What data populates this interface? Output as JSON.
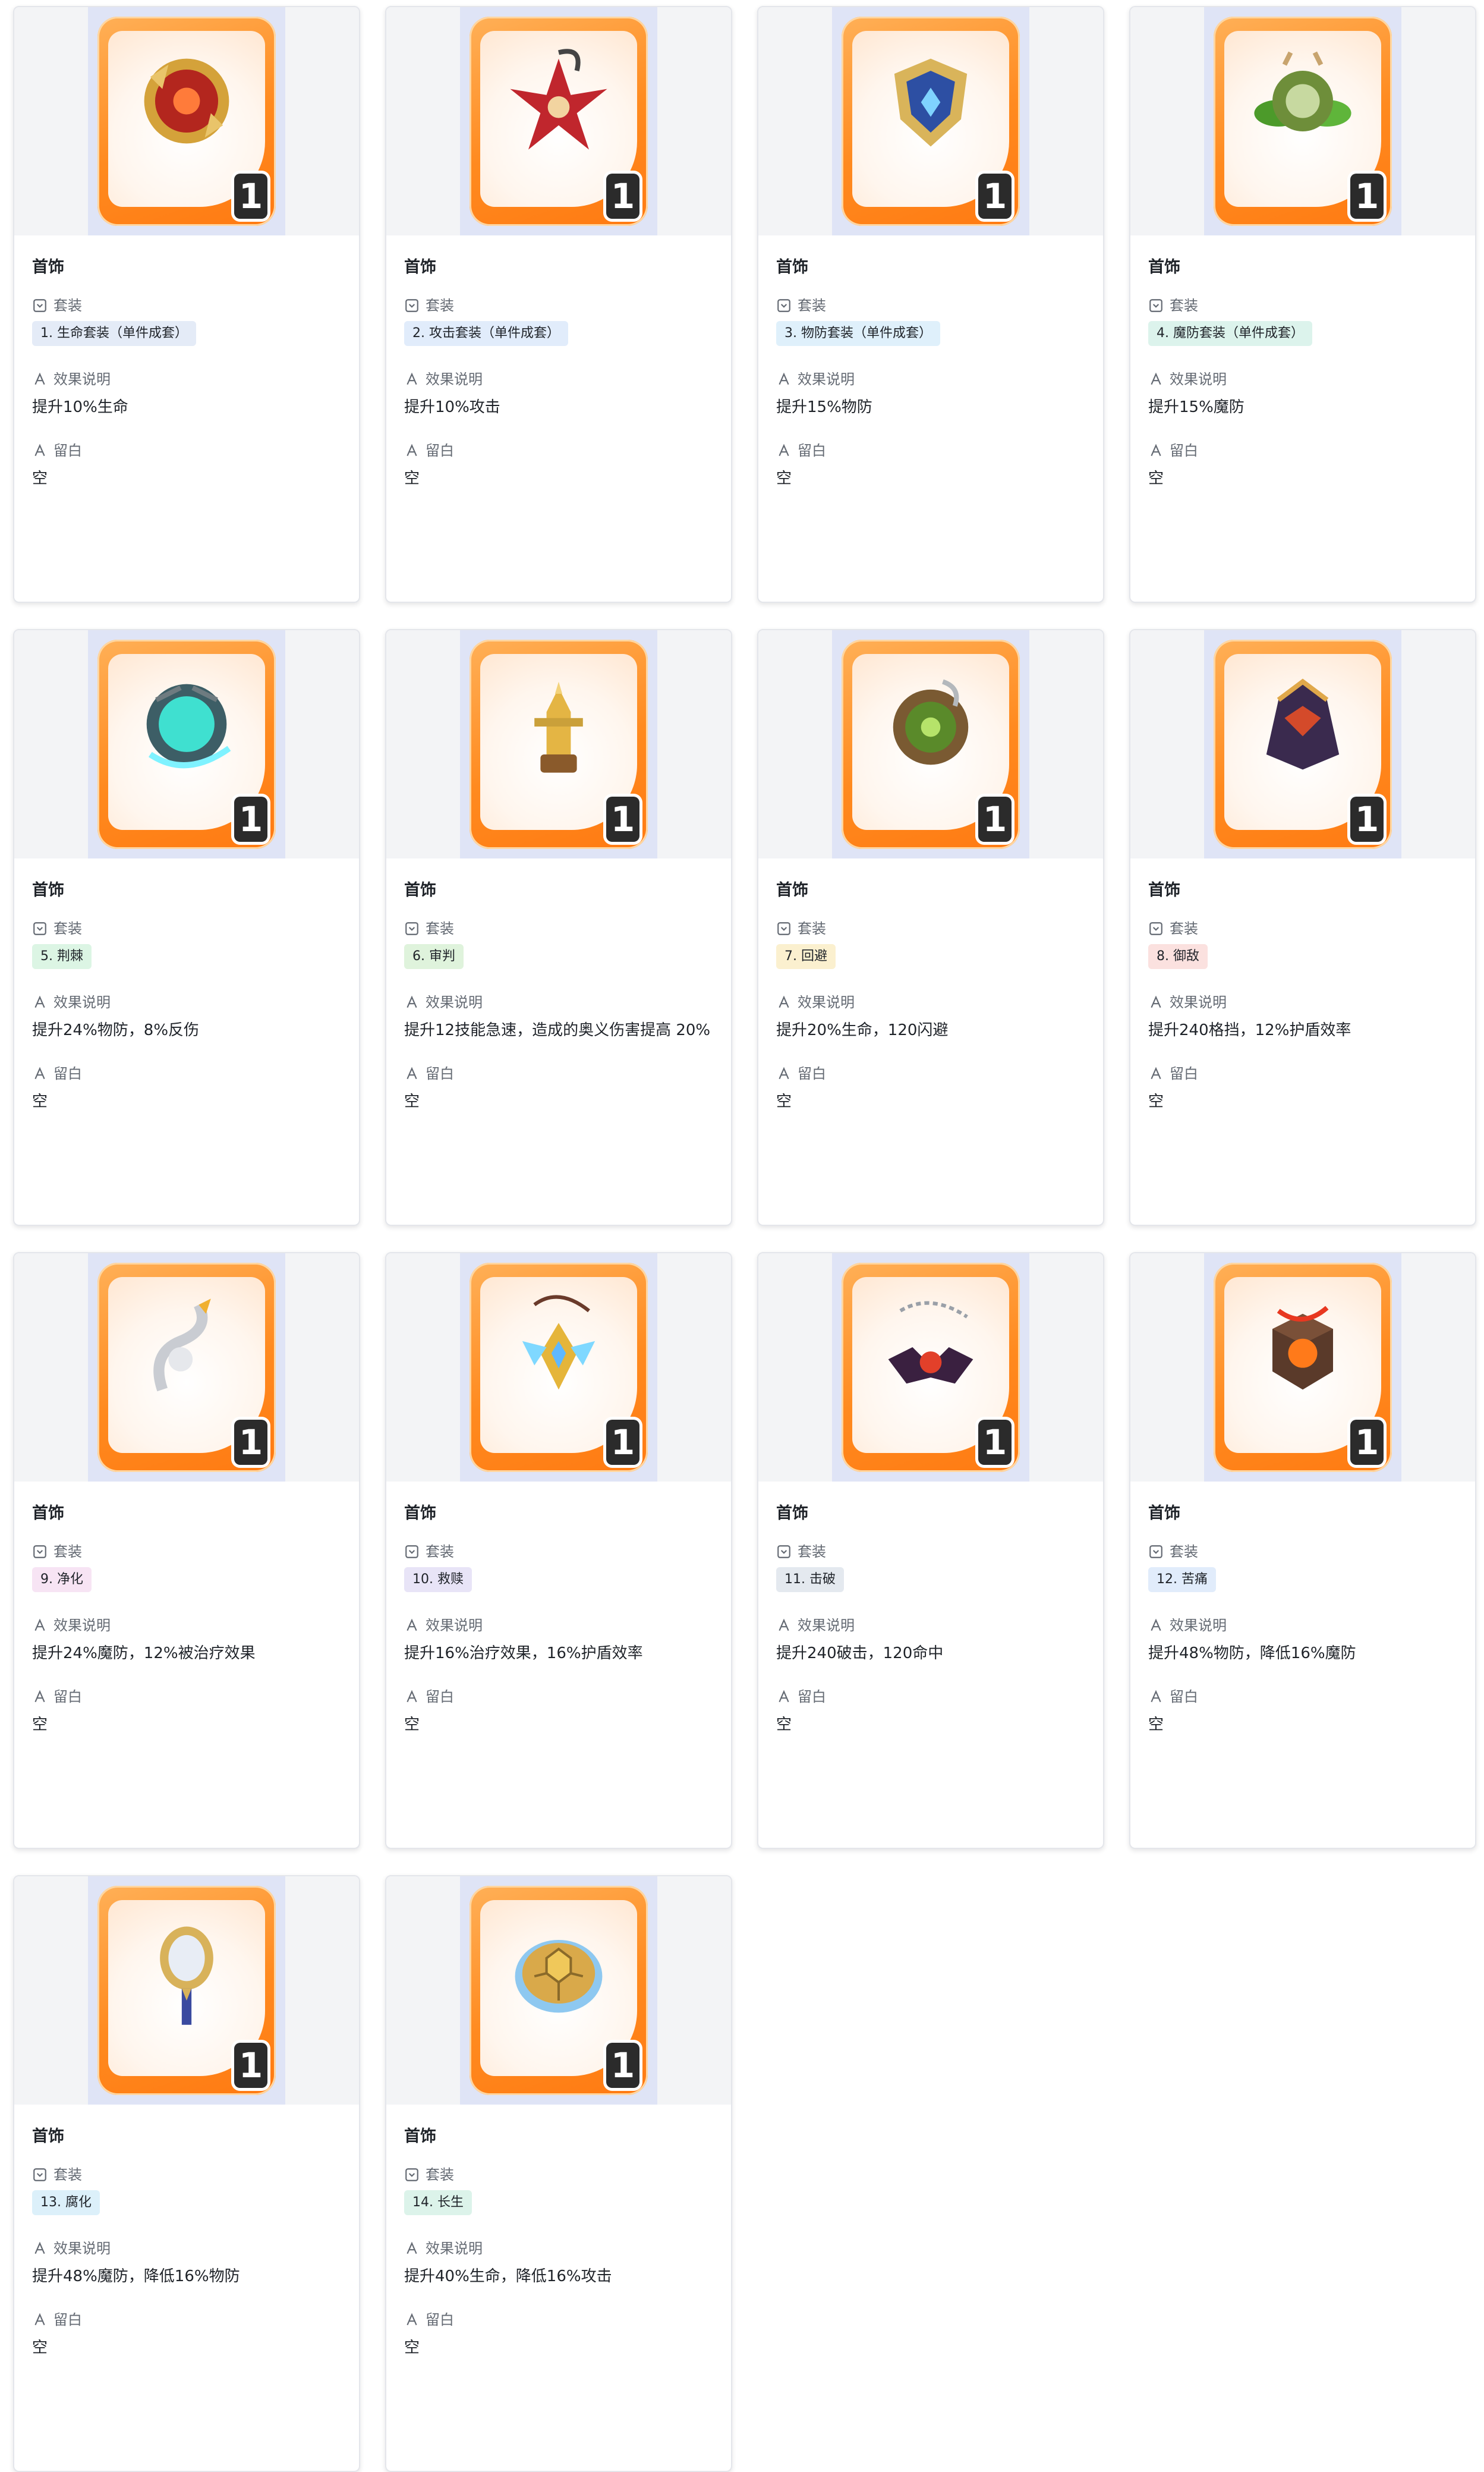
{
  "cards": [
    {
      "title": "首饰",
      "set_label": "套装",
      "set_value": "1. 生命套装（单件成套）",
      "tag_bg": "#e4ebf7",
      "effect_label": "效果说明",
      "effect_value": "提升10%生命",
      "remark_label": "留白",
      "remark_value": "空",
      "badge": "1",
      "icon": "red-gold-medallion-icon"
    },
    {
      "title": "首饰",
      "set_label": "套装",
      "set_value": "2. 攻击套装（单件成套）",
      "tag_bg": "#e1ecfb",
      "effect_label": "效果说明",
      "effect_value": "提升10%攻击",
      "remark_label": "留白",
      "remark_value": "空",
      "badge": "1",
      "icon": "crimson-lotus-icon"
    },
    {
      "title": "首饰",
      "set_label": "套装",
      "set_value": "3. 物防套装（单件成套）",
      "tag_bg": "#dff0fb",
      "effect_label": "效果说明",
      "effect_value": "提升15%物防",
      "remark_label": "留白",
      "remark_value": "空",
      "badge": "1",
      "icon": "winged-shield-icon"
    },
    {
      "title": "首饰",
      "set_label": "套装",
      "set_value": "4. 魔防套装（单件成套）",
      "tag_bg": "#dcf3ec",
      "effect_label": "效果说明",
      "effect_value": "提升15%魔防",
      "remark_label": "留白",
      "remark_value": "空",
      "badge": "1",
      "icon": "leaf-emblem-icon"
    },
    {
      "title": "首饰",
      "set_label": "套装",
      "set_value": "5. 荆棘",
      "tag_bg": "#dcf5e4",
      "effect_label": "效果说明",
      "effect_value": "提升24%物防，8%反伤",
      "remark_label": "留白",
      "remark_value": "空",
      "badge": "1",
      "icon": "cyan-crystal-orb-icon"
    },
    {
      "title": "首饰",
      "set_label": "套装",
      "set_value": "6. 审判",
      "tag_bg": "#dff3dc",
      "effect_label": "效果说明",
      "effect_value": "提升12技能急速，造成的奥义伤害提高 20%",
      "remark_label": "留白",
      "remark_value": "空",
      "badge": "1",
      "icon": "golden-knight-statue-icon"
    },
    {
      "title": "首饰",
      "set_label": "套装",
      "set_value": "7. 回避",
      "tag_bg": "#fbf0cf",
      "effect_label": "效果说明",
      "effect_value": "提升20%生命，120闪避",
      "remark_label": "留白",
      "remark_value": "空",
      "badge": "1",
      "icon": "tree-amulet-icon"
    },
    {
      "title": "首饰",
      "set_label": "套装",
      "set_value": "8. 御敌",
      "tag_bg": "#fbe1df",
      "effect_label": "效果说明",
      "effect_value": "提升240格挡，12%护盾效率",
      "remark_label": "留白",
      "remark_value": "空",
      "badge": "1",
      "icon": "dark-helmet-icon"
    },
    {
      "title": "首饰",
      "set_label": "套装",
      "set_value": "9. 净化",
      "tag_bg": "#f7e4f4",
      "effect_label": "效果说明",
      "effect_value": "提升24%魔防，12%被治疗效果",
      "remark_label": "留白",
      "remark_value": "空",
      "badge": "1",
      "icon": "silver-dragon-icon"
    },
    {
      "title": "首饰",
      "set_label": "套装",
      "set_value": "10. 救赎",
      "tag_bg": "#e8e4f7",
      "effect_label": "效果说明",
      "effect_value": "提升16%治疗效果，16%护盾效率",
      "remark_label": "留白",
      "remark_value": "空",
      "badge": "1",
      "icon": "winged-pendant-icon"
    },
    {
      "title": "首饰",
      "set_label": "套装",
      "set_value": "11. 击破",
      "tag_bg": "#e4e9ef",
      "effect_label": "效果说明",
      "effect_value": "提升240破击，120命中",
      "remark_label": "留白",
      "remark_value": "空",
      "badge": "1",
      "icon": "bat-chain-necklace-icon"
    },
    {
      "title": "首饰",
      "set_label": "套装",
      "set_value": "12. 苦痛",
      "tag_bg": "#e1ecfb",
      "effect_label": "效果说明",
      "effect_value": "提升48%物防，降低16%魔防",
      "remark_label": "留白",
      "remark_value": "空",
      "badge": "1",
      "icon": "lava-cube-icon"
    },
    {
      "title": "首饰",
      "set_label": "套装",
      "set_value": "13. 腐化",
      "tag_bg": "#dcf0fa",
      "effect_label": "效果说明",
      "effect_value": "提升48%魔防，降低16%物防",
      "remark_label": "留白",
      "remark_value": "空",
      "badge": "1",
      "icon": "mirror-scepter-icon"
    },
    {
      "title": "首饰",
      "set_label": "套装",
      "set_value": "14. 长生",
      "tag_bg": "#dcf3ea",
      "effect_label": "效果说明",
      "effect_value": "提升40%生命，降低16%攻击",
      "remark_label": "留白",
      "remark_value": "空",
      "badge": "1",
      "icon": "turtle-shell-icon"
    }
  ]
}
